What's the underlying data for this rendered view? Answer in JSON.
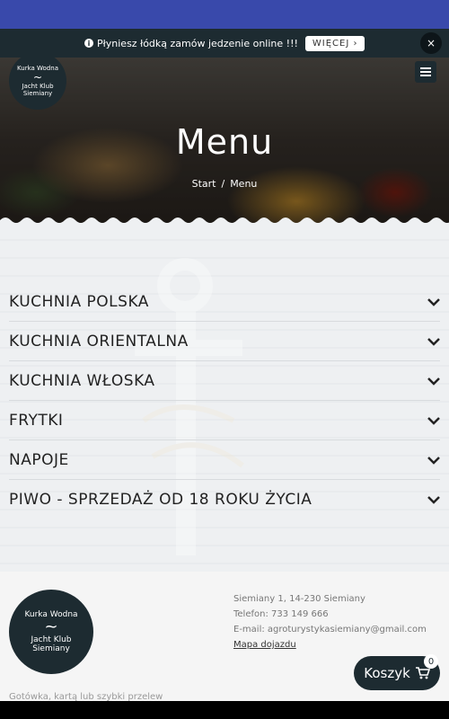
{
  "notice": {
    "text": "Płyniesz łódką zamów jedzenie online !!!",
    "more_label": "WIĘCEJ ›",
    "close_label": "×"
  },
  "brand": {
    "line1": "Kurka Wodna",
    "line2": "Jacht Klub",
    "line3": "Siemiany"
  },
  "hero": {
    "title": "Menu",
    "breadcrumb_start": "Start",
    "breadcrumb_sep": "/",
    "breadcrumb_current": "Menu"
  },
  "menu_categories": [
    "KUCHNIA POLSKA",
    "KUCHNIA ORIENTALNA",
    "KUCHNIA WŁOSKA",
    "FRYTKI",
    "NAPOJE",
    "PIWO - SPRZEDAŻ OD 18 ROKU ŻYCIA"
  ],
  "footer": {
    "address": "Siemiany 1, 14-230 Siemiany",
    "phone": "Telefon: 733 149 666",
    "email": "E-mail: agroturystykasiemiany@gmail.com",
    "map_link": "Mapa dojazdu",
    "payment": "Gotówka, kartą lub szybki przelew"
  },
  "cart": {
    "label": "Koszyk",
    "count": "0"
  },
  "colors": {
    "top_strip": "#3949ab",
    "dark": "#1d2b31"
  }
}
